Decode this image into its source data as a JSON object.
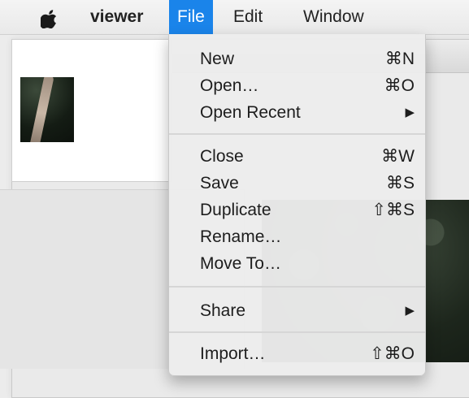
{
  "menubar": {
    "app_name": "viewer",
    "items": [
      {
        "label": "File",
        "active": true
      },
      {
        "label": "Edit"
      },
      {
        "label": "Window"
      }
    ]
  },
  "file_menu": {
    "groups": [
      [
        {
          "label": "New",
          "shortcut": "⌘N"
        },
        {
          "label": "Open…",
          "shortcut": "⌘O"
        },
        {
          "label": "Open Recent",
          "shortcut": "▶"
        }
      ],
      [
        {
          "label": "Close",
          "shortcut": "⌘W"
        },
        {
          "label": "Save",
          "shortcut": "⌘S"
        },
        {
          "label": "Duplicate",
          "shortcut": "⇧⌘S"
        },
        {
          "label": "Rename…",
          "shortcut": ""
        },
        {
          "label": "Move To…",
          "shortcut": ""
        }
      ],
      [
        {
          "label": "Share",
          "shortcut": "▶"
        }
      ],
      [
        {
          "label": "Import…",
          "shortcut": "⇧⌘O"
        }
      ]
    ]
  },
  "colors": {
    "menu_highlight": "#1a84ea",
    "traffic_close": "#fc5f57",
    "traffic_minimize": "#fdbc2e",
    "traffic_maximize": "#28c840"
  }
}
